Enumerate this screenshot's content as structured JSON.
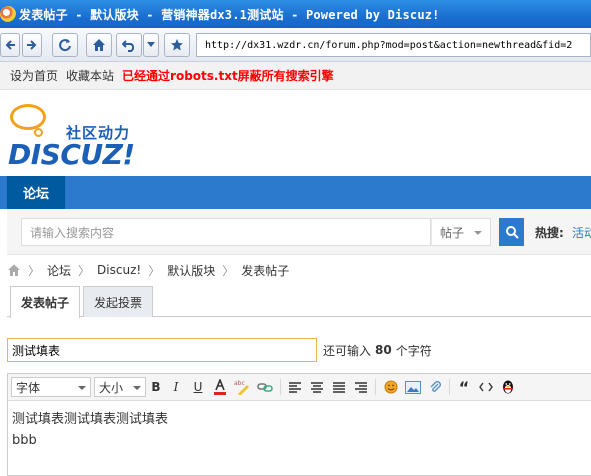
{
  "window": {
    "title": "发表帖子 - 默认版块 - 营销神器dx3.1测试站 - Powered by Discuz!"
  },
  "browser": {
    "address": "http://dx31.wzdr.cn/forum.php?mod=post&action=newthread&fid=2"
  },
  "toplinks": {
    "home": "设为首页",
    "fav": "收藏本站",
    "notice": "已经通过robots.txt屏蔽所有搜索引擎"
  },
  "logo": {
    "community": "社区动力",
    "wordmark": "DISCUZ!"
  },
  "nav": {
    "forum": "论坛"
  },
  "search": {
    "placeholder": "请输入搜索内容",
    "type": "帖子",
    "hot_label": "热搜:",
    "hot_link": "活动"
  },
  "breadcrumb": [
    "论坛",
    "Discuz!",
    "默认版块",
    "发表帖子"
  ],
  "tabs": {
    "post": "发表帖子",
    "poll": "发起投票"
  },
  "subject": {
    "value": "测试填表",
    "remaining_prefix": "还可输入",
    "remaining_count": "80",
    "remaining_suffix": "个字符"
  },
  "editor": {
    "font_label": "字体",
    "size_label": "大小",
    "line1": "测试填表测试填表测试填表",
    "line2": "bbb"
  }
}
